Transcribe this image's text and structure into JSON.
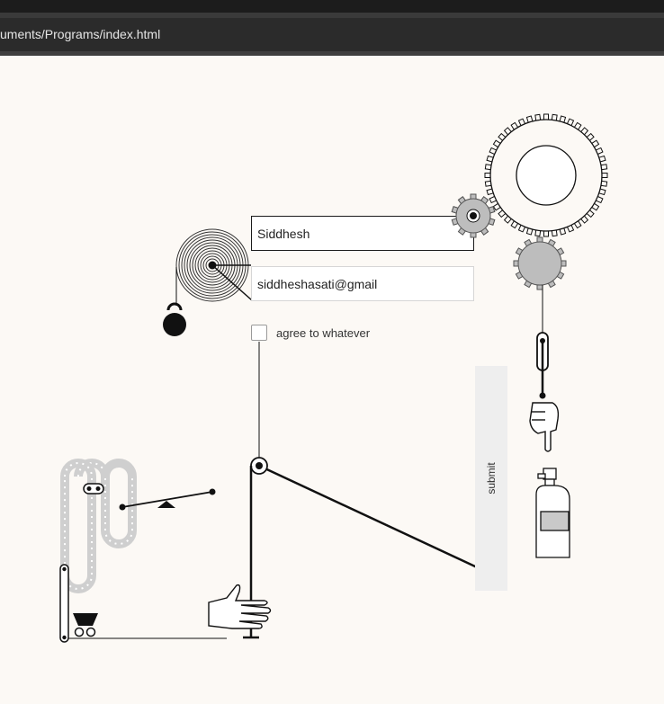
{
  "browser": {
    "address": "uments/Programs/index.html"
  },
  "form": {
    "name_value": "Siddhesh",
    "email_value": "siddheshasati@gmail",
    "checkbox_label": "agree to whatever",
    "checkbox_checked": false,
    "submit_label": "submit"
  },
  "machine_icons": [
    "spiral-spring-icon",
    "kettlebell-icon",
    "gear-icon",
    "pulley-icon",
    "pointing-hand-icon",
    "spray-bottle-icon",
    "chain-loop-icon",
    "seesaw-icon",
    "cart-icon",
    "open-hand-icon"
  ],
  "colors": {
    "background": "#fcf9f5",
    "ink": "#111111",
    "gear_fill": "#bdbdbd",
    "chain": "#cfcfcf",
    "submit_bg": "#eeeeee",
    "browser_bar": "#2b2b2b"
  }
}
